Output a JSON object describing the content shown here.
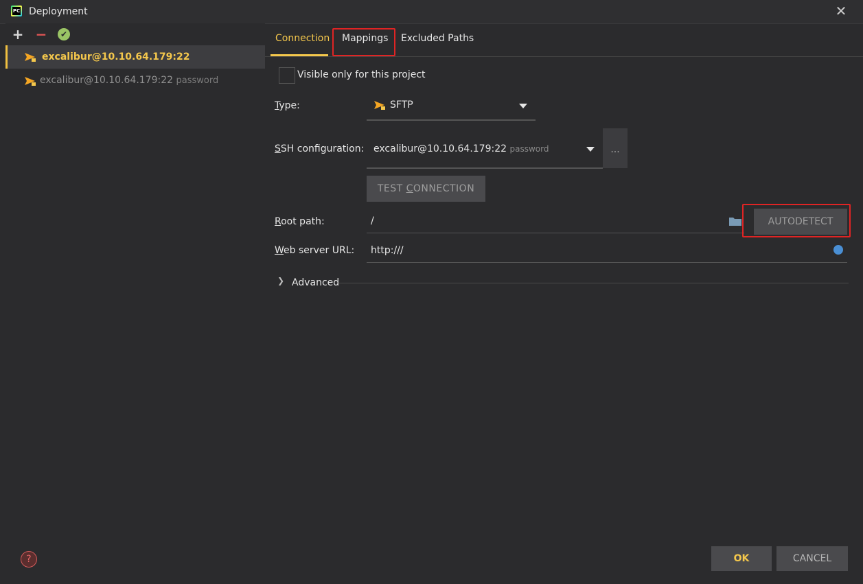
{
  "window": {
    "title": "Deployment"
  },
  "toolbar": {
    "add": "+",
    "remove": "−",
    "check": "✔"
  },
  "servers": [
    {
      "name": "excalibur@10.10.64.179:22",
      "sub": ""
    },
    {
      "name": "excalibur@10.10.64.179:22",
      "sub": "password"
    }
  ],
  "tabs": {
    "connection": "Connection",
    "mappings": "Mappings",
    "excluded": "Excluded Paths"
  },
  "form": {
    "visible_only": "Visible only for this project",
    "type_label_first": "T",
    "type_label_rest": "ype:",
    "type_value": "SFTP",
    "ssh_label_first": "S",
    "ssh_label_rest": "SH configuration:",
    "ssh_value": "excalibur@10.10.64.179:22",
    "ssh_sub": "password",
    "dots": "...",
    "test_a": "TEST ",
    "test_b": "C",
    "test_c": "ONNECTION",
    "root_label_first": "R",
    "root_label_rest": "oot path:",
    "root_value": "/",
    "autodetect": "AUTODETECT",
    "web_label_first": "W",
    "web_label_rest": "eb server URL:",
    "web_value": "http:///",
    "advanced": "Advanced"
  },
  "footer": {
    "ok": "OK",
    "cancel": "CANCEL",
    "help": "?"
  },
  "colors": {
    "accent": "#f5c84c",
    "highlight": "#e02424",
    "bg": "#2b2b2d"
  }
}
